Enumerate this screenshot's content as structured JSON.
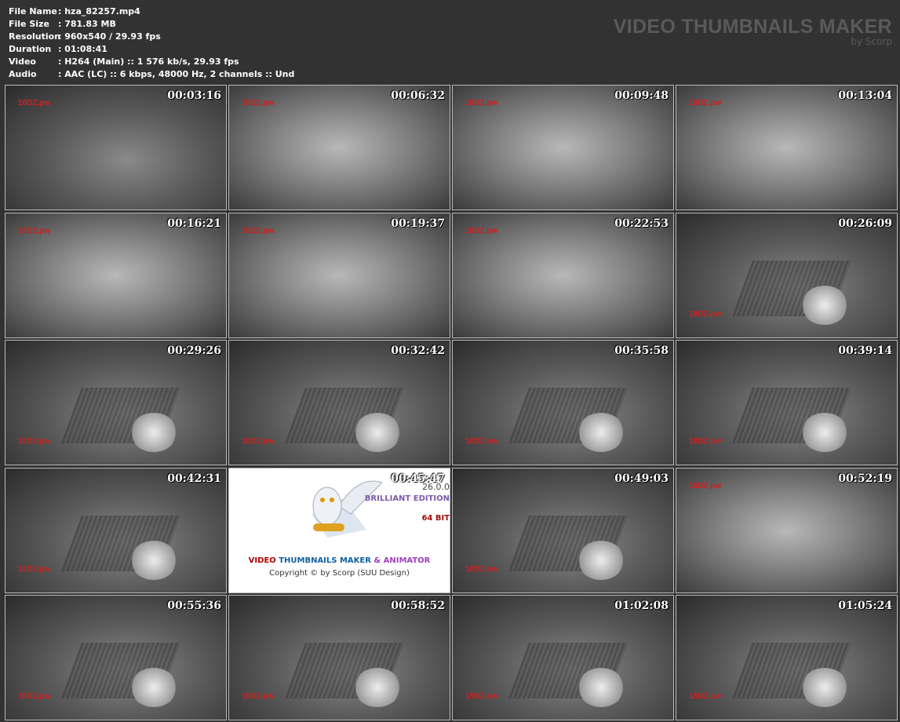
{
  "info": [
    {
      "key": "File Name",
      "value": ": hza_82257.mp4"
    },
    {
      "key": "File Size",
      "value": ": 781.83 MB"
    },
    {
      "key": "Resolution",
      "value": ": 960x540 / 29.93 fps"
    },
    {
      "key": "Duration",
      "value": ": 01:08:41"
    },
    {
      "key": "Video",
      "value": ": H264 (Main) :: 1 576 kb/s, 29.93 fps"
    },
    {
      "key": "Audio",
      "value": ": AAC (LC) :: 6 kbps, 48000 Hz, 2 channels :: Und"
    }
  ],
  "brand": {
    "title": "VIDEO THUMBNAILS MAKER",
    "by": "by Scorp"
  },
  "watermark": "18DZ.pw",
  "thumbnails": [
    "00:03:16",
    "00:06:32",
    "00:09:48",
    "00:13:04",
    "00:16:21",
    "00:19:37",
    "00:22:53",
    "00:26:09",
    "00:29:26",
    "00:32:42",
    "00:35:58",
    "00:39:14",
    "00:42:31",
    "00:45:47",
    "00:49:03",
    "00:52:19",
    "00:55:36",
    "00:58:52",
    "01:02:08",
    "01:05:24"
  ],
  "promo": {
    "version": "26.0.0",
    "edition": "BRILLIANT EDITION",
    "bits": "64 BIT",
    "title_parts": [
      "VIDEO ",
      "THUMBNAILS MAKER",
      " & ANIMATOR"
    ],
    "copyright": "Copyright © by Scorp (SUU Design)",
    "colors": [
      "#b00000",
      "#1060a0",
      "#a040c0"
    ]
  }
}
